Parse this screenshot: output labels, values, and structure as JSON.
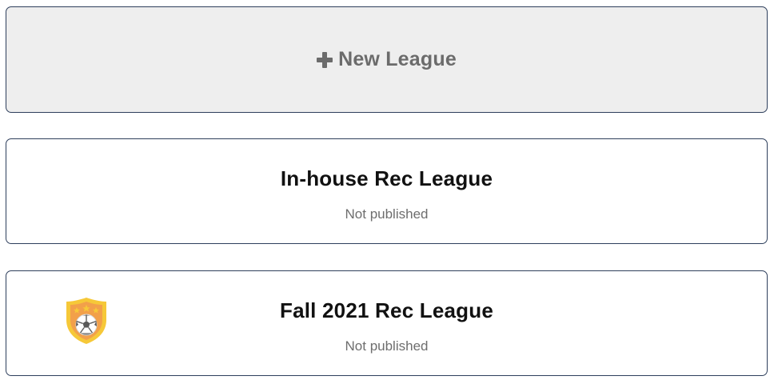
{
  "new_league": {
    "label": "New League",
    "icon": "plus-icon"
  },
  "leagues": [
    {
      "title": "In-house Rec League",
      "status": "Not published",
      "has_logo": false
    },
    {
      "title": "Fall 2021 Rec League",
      "status": "Not published",
      "has_logo": true,
      "logo_icon": "soccer-shield-icon"
    }
  ],
  "colors": {
    "card_border": "#2e3f5c",
    "new_league_bg": "#eeeeee",
    "new_league_text": "#6b6b6b",
    "status_text": "#6e6e6e",
    "shield_orange": "#f2a04a",
    "shield_yellow": "#f6c838"
  }
}
